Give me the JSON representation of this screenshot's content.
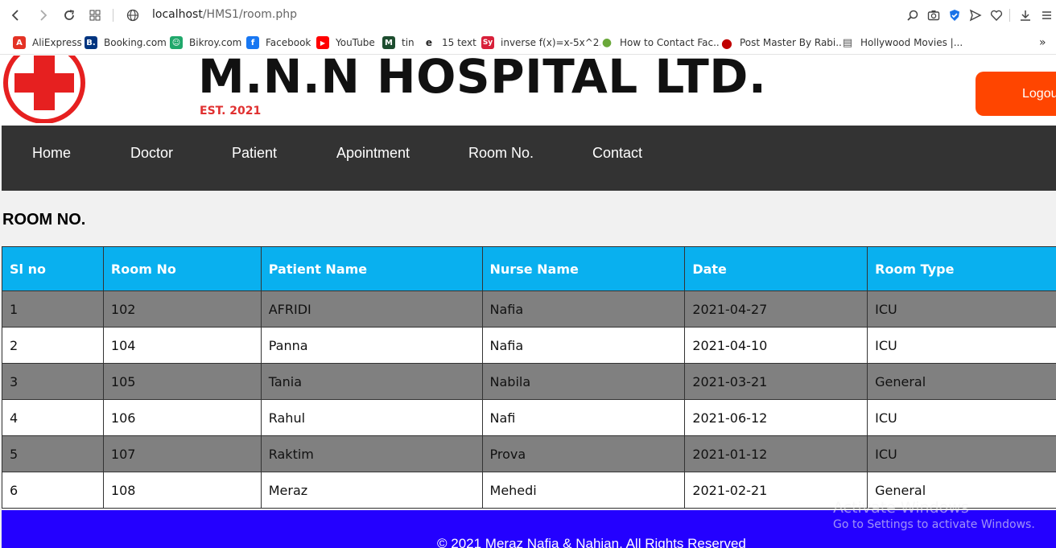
{
  "browser": {
    "url_host": "localhost",
    "url_path": "/HMS1/room.php",
    "bookmarks": [
      {
        "label": "AliExpress",
        "color": "#e43225",
        "glyph": "A"
      },
      {
        "label": "Booking.com",
        "color": "#003580",
        "glyph": "B."
      },
      {
        "label": "Bikroy.com",
        "color": "#20a86b",
        "glyph": "☺"
      },
      {
        "label": "Facebook",
        "color": "#1877f2",
        "glyph": "f"
      },
      {
        "label": "YouTube",
        "color": "#ff0000",
        "glyph": "▶"
      },
      {
        "label": "tin",
        "color": "#1d4d2f",
        "glyph": "M"
      },
      {
        "label": "15 text",
        "color": "#222222",
        "glyph": "e"
      },
      {
        "label": "inverse f(x)=x-5x^2...",
        "color": "#d8203a",
        "glyph": "Sy"
      },
      {
        "label": "How to Contact Fac...",
        "color": "#6aa83a",
        "glyph": "●"
      },
      {
        "label": "Post Master By Rabi...",
        "color": "#c00000",
        "glyph": "●"
      },
      {
        "label": "Hollywood Movies |...",
        "color": "#555555",
        "glyph": "▤"
      }
    ]
  },
  "header": {
    "brand": "M.N.N HOSPITAL LTD.",
    "est": "EST. 2021",
    "logout_label": "Logout"
  },
  "nav": {
    "items": [
      "Home",
      "Doctor",
      "Patient",
      "Apointment",
      "Room No.",
      "Contact"
    ]
  },
  "main": {
    "title": "ROOM NO.",
    "columns": [
      "Sl no",
      "Room No",
      "Patient Name",
      "Nurse Name",
      "Date",
      "Room Type"
    ],
    "rows": [
      [
        "1",
        "102",
        "AFRIDI",
        "Nafia",
        "2021-04-27",
        "ICU"
      ],
      [
        "2",
        "104",
        "Panna",
        "Nafia",
        "2021-04-10",
        "ICU"
      ],
      [
        "3",
        "105",
        "Tania",
        "Nabila",
        "2021-03-21",
        "General"
      ],
      [
        "4",
        "106",
        "Rahul",
        "Nafi",
        "2021-06-12",
        "ICU"
      ],
      [
        "5",
        "107",
        "Raktim",
        "Prova",
        "2021-01-12",
        "ICU"
      ],
      [
        "6",
        "108",
        "Meraz",
        "Mehedi",
        "2021-02-21",
        "General"
      ]
    ]
  },
  "footer": {
    "copyright": "© 2021 Meraz Nafia & Nahian, All Rights Reserved"
  },
  "watermark": {
    "line1": "Activate Windows",
    "line2": "Go to Settings to activate Windows."
  },
  "colors": {
    "nav_bg": "#333333",
    "table_header": "#09b0ef",
    "logout": "#ff4500",
    "footer": "#2400ff",
    "logo_red": "#e62020"
  }
}
